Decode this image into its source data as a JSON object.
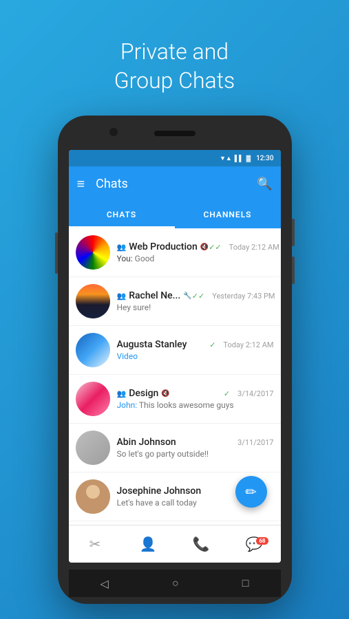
{
  "header": {
    "title": "Private and\nGroup Chats"
  },
  "statusBar": {
    "time": "12:30",
    "wifi": "▼▲",
    "signal": "▌▌▌",
    "battery": "▓"
  },
  "appBar": {
    "title": "Chats",
    "hamburgerIcon": "≡",
    "searchIcon": "🔍"
  },
  "tabs": [
    {
      "label": "CHATS",
      "active": true
    },
    {
      "label": "CHANNELS",
      "active": false
    }
  ],
  "chats": [
    {
      "id": 1,
      "name": "Web Production",
      "isGroup": true,
      "muted": true,
      "wrench": false,
      "time": "Today 2:12 AM",
      "preview": "You: Good",
      "senderName": "You",
      "message": "Good",
      "avatarType": "colorful",
      "checkDouble": true
    },
    {
      "id": 2,
      "name": "Rachel Ne...",
      "isGroup": true,
      "muted": false,
      "wrench": true,
      "time": "Yesterday 7:43 PM",
      "preview": "Hey sure!",
      "senderName": "",
      "message": "Hey sure!",
      "avatarType": "sunset",
      "checkDouble": true
    },
    {
      "id": 3,
      "name": "Augusta Stanley",
      "isGroup": false,
      "muted": false,
      "wrench": false,
      "time": "Today 2:12 AM",
      "preview": "Video",
      "senderName": "",
      "message": "Video",
      "avatarType": "blue",
      "checkSingle": true,
      "previewBlue": true
    },
    {
      "id": 4,
      "name": "Design",
      "isGroup": true,
      "muted": true,
      "wrench": false,
      "time": "3/14/2017",
      "preview": "John: This looks awesome guys",
      "senderName": "John",
      "message": "This looks awesome guys",
      "avatarType": "pink",
      "checkSingle": true
    },
    {
      "id": 5,
      "name": "Abin Johnson",
      "isGroup": false,
      "muted": false,
      "wrench": false,
      "time": "3/11/2017",
      "preview": "So let's go party outside!!",
      "senderName": "",
      "message": "So let's go party outside!!",
      "avatarType": "gray",
      "checkNone": true
    },
    {
      "id": 6,
      "name": "Josephine Johnson",
      "isGroup": false,
      "muted": false,
      "wrench": false,
      "time": "",
      "preview": "Let's have a call today",
      "senderName": "",
      "message": "Let's have a call today",
      "avatarType": "person",
      "checkNone": true
    }
  ],
  "fab": {
    "icon": "✏",
    "label": "compose"
  },
  "bottomNav": [
    {
      "icon": "✂",
      "label": "scissors",
      "badge": null
    },
    {
      "icon": "👤",
      "label": "person",
      "badge": null
    },
    {
      "icon": "📞",
      "label": "phone",
      "badge": null
    },
    {
      "icon": "💬",
      "label": "chat",
      "badge": "68"
    }
  ],
  "phoneNav": [
    {
      "icon": "◁",
      "label": "back"
    },
    {
      "icon": "○",
      "label": "home"
    },
    {
      "icon": "□",
      "label": "recent"
    }
  ]
}
